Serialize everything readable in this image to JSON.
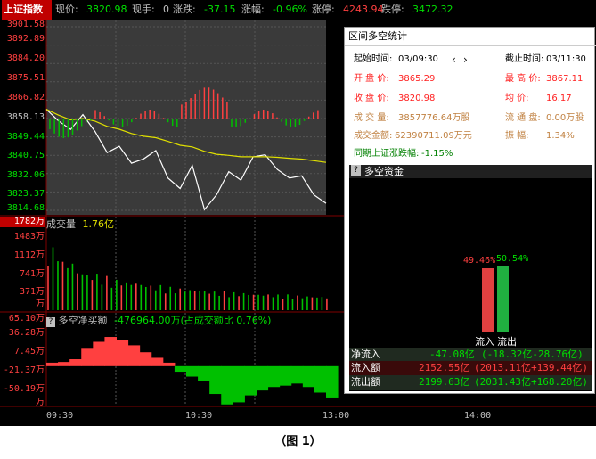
{
  "header": {
    "index_name": "上证指数",
    "price_label": "现价:",
    "price": "3820.98",
    "hand_label": "现手:",
    "hand": "0",
    "chg_label": "涨跌:",
    "chg": "-37.15",
    "pct_label": "涨幅:",
    "pct": "-0.96%",
    "up_limit_label": "涨停:",
    "up_limit": "4243.94",
    "down_limit_label": "跌停:",
    "down_limit": "3472.32"
  },
  "price_axis": [
    "3901.58",
    "3892.89",
    "3884.20",
    "3875.51",
    "3866.82",
    "3858.13",
    "3849.44",
    "3840.75",
    "3832.06",
    "3823.37",
    "3814.68"
  ],
  "volume": {
    "label": "成交量",
    "value": "1.76亿",
    "axis_top": "1782万",
    "axis": [
      "1483万",
      "1112万",
      "741万",
      "371万",
      "万"
    ]
  },
  "fund": {
    "help_icon": "?",
    "label": "多空净买额",
    "value": "-476964.00万(占成交额比 0.76%)",
    "axis": [
      "65.10万",
      "36.28万",
      "7.45万",
      "-21.37万",
      "-50.19万",
      "万"
    ]
  },
  "time_axis": [
    "09:30",
    "10:30",
    "13:00",
    "14:00"
  ],
  "stats_panel": {
    "title": "区间多空统计",
    "start_label": "起始时间:",
    "start_time": "03/09:30",
    "prev_icon": "‹",
    "next_icon": "›",
    "end_label": "截止时间:",
    "end_time": "03/11:30",
    "open_label": "开 盘 价:",
    "open": "3865.29",
    "high_label": "最 高 价:",
    "high": "3867.11",
    "close_label": "收 盘 价:",
    "close": "3820.98",
    "avg_label": "均    价:",
    "avg": "16.17",
    "vol_label": "成 交 量:",
    "vol": "3857776.64万股",
    "float_label": "流 通 盘:",
    "float": "0.00万股",
    "amount_label": "成交金额:",
    "amount": "62390711.09万元",
    "amp_label": "振    幅:",
    "amp": "1.34%",
    "rise_label": "同期上证涨跌幅:",
    "rise": "-1.15%"
  },
  "flow_panel": {
    "help_icon": "?",
    "title": "多空资金",
    "inflow_pct": "49.46%",
    "outflow_pct": "50.54%",
    "inflow_bar_label": "流入",
    "outflow_bar_label": "流出",
    "net_label": "净流入",
    "net_value": "-47.08亿",
    "net_detail": "(-18.32亿-28.76亿)",
    "in_label": "流入额",
    "in_value": "2152.55亿",
    "in_detail": "(2013.11亿+139.44亿)",
    "out_label": "流出额",
    "out_value": "2199.63亿",
    "out_detail": "(2031.43亿+168.20亿)"
  },
  "chart_data": [
    {
      "type": "line",
      "series": [
        {
          "values": [
            3862.5,
            3857,
            3853,
            3860,
            3852,
            3842,
            3845,
            3837,
            3839,
            3843,
            3830,
            3825,
            3836,
            3815,
            3822,
            3833,
            3829,
            3840,
            3841,
            3834,
            3830,
            3831,
            3822,
            3818
          ]
        }
      ],
      "ylim": [
        3814.68,
        3901.58
      ],
      "grid": true
    },
    {
      "type": "bar",
      "values": [
        1400,
        1100,
        900,
        820,
        760,
        680,
        640,
        600,
        560,
        520,
        490,
        470,
        440,
        420,
        400,
        390,
        370,
        360,
        350,
        330,
        320,
        310
      ],
      "ylim": [
        0,
        1782
      ]
    },
    {
      "type": "area",
      "values": [
        5,
        6,
        10,
        25,
        35,
        42,
        38,
        30,
        20,
        12,
        5,
        -8,
        -15,
        -22,
        -40,
        -55,
        -52,
        -42,
        -35,
        -30,
        -28,
        -25,
        -30,
        -38,
        -45
      ],
      "ylim": [
        -50.19,
        65.1
      ]
    }
  ],
  "colors": {
    "up": "#ff4040",
    "down": "#00c000",
    "price_line": "#ffffff",
    "avg_line": "#e0e000",
    "axis": "#800000"
  }
}
